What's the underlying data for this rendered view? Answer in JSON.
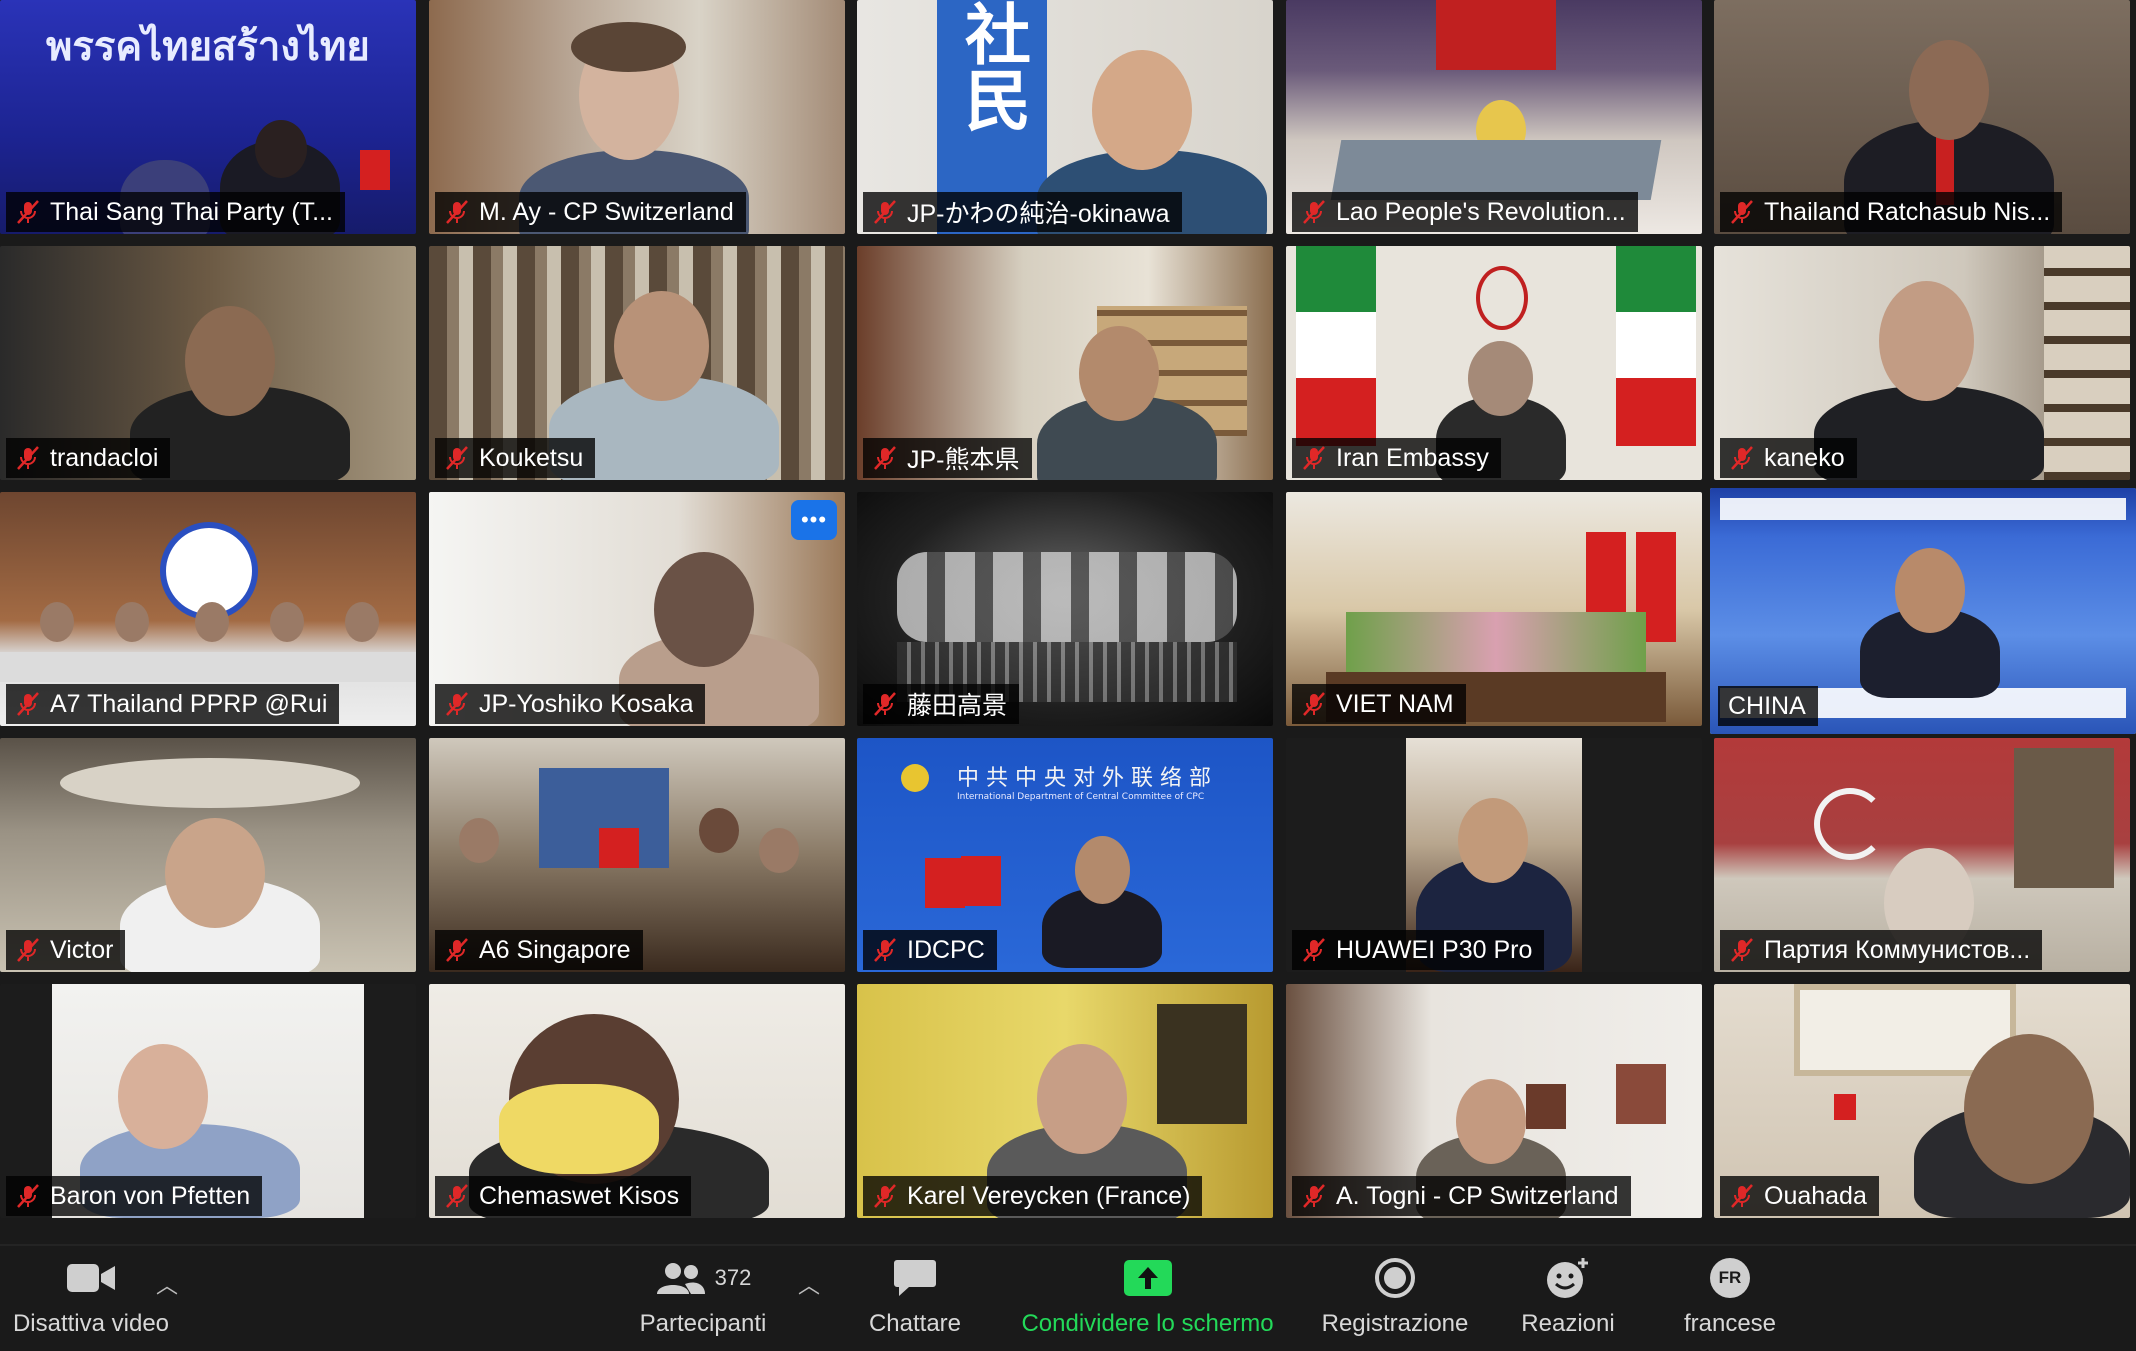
{
  "participants": [
    {
      "name": "Thai Sang Thai Party (T...",
      "banner": "พรรคไทยสร้างไทย"
    },
    {
      "name": "M. Ay - CP Switzerland"
    },
    {
      "name": "JP-かわの純治-okinawa",
      "banner": "社民"
    },
    {
      "name": "Lao People's Revolution..."
    },
    {
      "name": "Thailand Ratchasub Nis..."
    },
    {
      "name": "trandacloi"
    },
    {
      "name": "Kouketsu"
    },
    {
      "name": "JP-熊本県"
    },
    {
      "name": "Iran Embassy"
    },
    {
      "name": "kaneko"
    },
    {
      "name": "A7 Thailand PPRP @Rui"
    },
    {
      "name": "JP-Yoshiko Kosaka"
    },
    {
      "name": "藤田高景"
    },
    {
      "name": "VIET NAM"
    },
    {
      "name": "CHINA"
    },
    {
      "name": "Victor"
    },
    {
      "name": "A6 Singapore"
    },
    {
      "name": "IDCPC",
      "banner": "中共中央对外联络部",
      "banner_sub": "International Department of Central Committee of CPC"
    },
    {
      "name": "HUAWEI P30 Pro"
    },
    {
      "name": "Партия Коммунистов..."
    },
    {
      "name": "Baron von Pfetten"
    },
    {
      "name": "Chemaswet Kisos"
    },
    {
      "name": "Karel Vereycken (France)"
    },
    {
      "name": "A. Togni - CP Switzerland"
    },
    {
      "name": "Ouahada"
    }
  ],
  "more_button": "•••",
  "toolbar": {
    "video": {
      "label": "Disattiva video",
      "icon": "video-camera-icon"
    },
    "participants": {
      "label": "Partecipanti",
      "count": "372",
      "icon": "people-icon"
    },
    "chat": {
      "label": "Chattare",
      "icon": "chat-bubble-icon"
    },
    "share": {
      "label": "Condividere lo schermo",
      "icon": "share-screen-icon",
      "color": "#23d959"
    },
    "record": {
      "label": "Registrazione",
      "icon": "record-icon"
    },
    "reactions": {
      "label": "Reazioni",
      "icon": "smiley-plus-icon"
    },
    "language": {
      "label": "francese",
      "badge": "FR",
      "icon": "language-badge-icon"
    }
  },
  "colors": {
    "muted_mic": "#e02828",
    "active_border": "#f1e85a",
    "toolbar_bg": "#1a1a1a",
    "share_green": "#23d959"
  }
}
